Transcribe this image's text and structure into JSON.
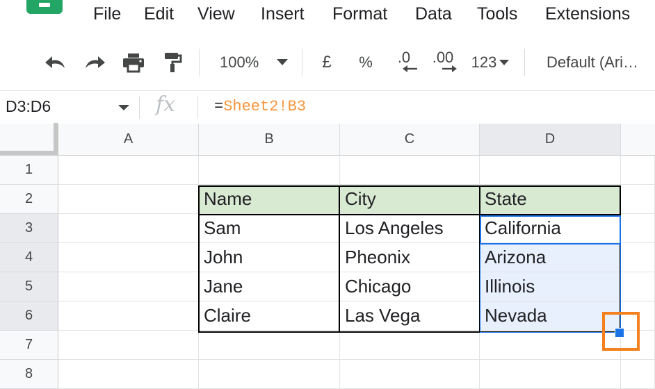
{
  "menu": {
    "items": [
      "File",
      "Edit",
      "View",
      "Insert",
      "Format",
      "Data",
      "Tools",
      "Extensions"
    ]
  },
  "toolbar": {
    "zoom": "100%",
    "currency": "£",
    "percent": "%",
    "decrease_decimal": ".0",
    "increase_decimal": ".00",
    "more_formats": "123",
    "font": "Default (Ari…"
  },
  "formula_bar": {
    "name_box": "D3:D6",
    "equals": "=",
    "reference": "Sheet2!B3"
  },
  "sheet": {
    "columns": [
      "A",
      "B",
      "C",
      "D"
    ],
    "rows": [
      "1",
      "2",
      "3",
      "4",
      "5",
      "6",
      "7",
      "8"
    ],
    "table": {
      "headers": [
        "Name",
        "City",
        "State"
      ],
      "rows": [
        [
          "Sam",
          "Los Angeles",
          "California"
        ],
        [
          "John",
          "Pheonix",
          "Arizona"
        ],
        [
          "Jane",
          "Chicago",
          "Illinois"
        ],
        [
          "Claire",
          "Las Vega",
          "Nevada"
        ]
      ]
    }
  },
  "colors": {
    "header_fill": "#d9ead3",
    "selection": "#1a73e8",
    "selection_fill": "#e8f0fe",
    "formula_reference": "#f6953b",
    "highlight": "#f3811f"
  }
}
